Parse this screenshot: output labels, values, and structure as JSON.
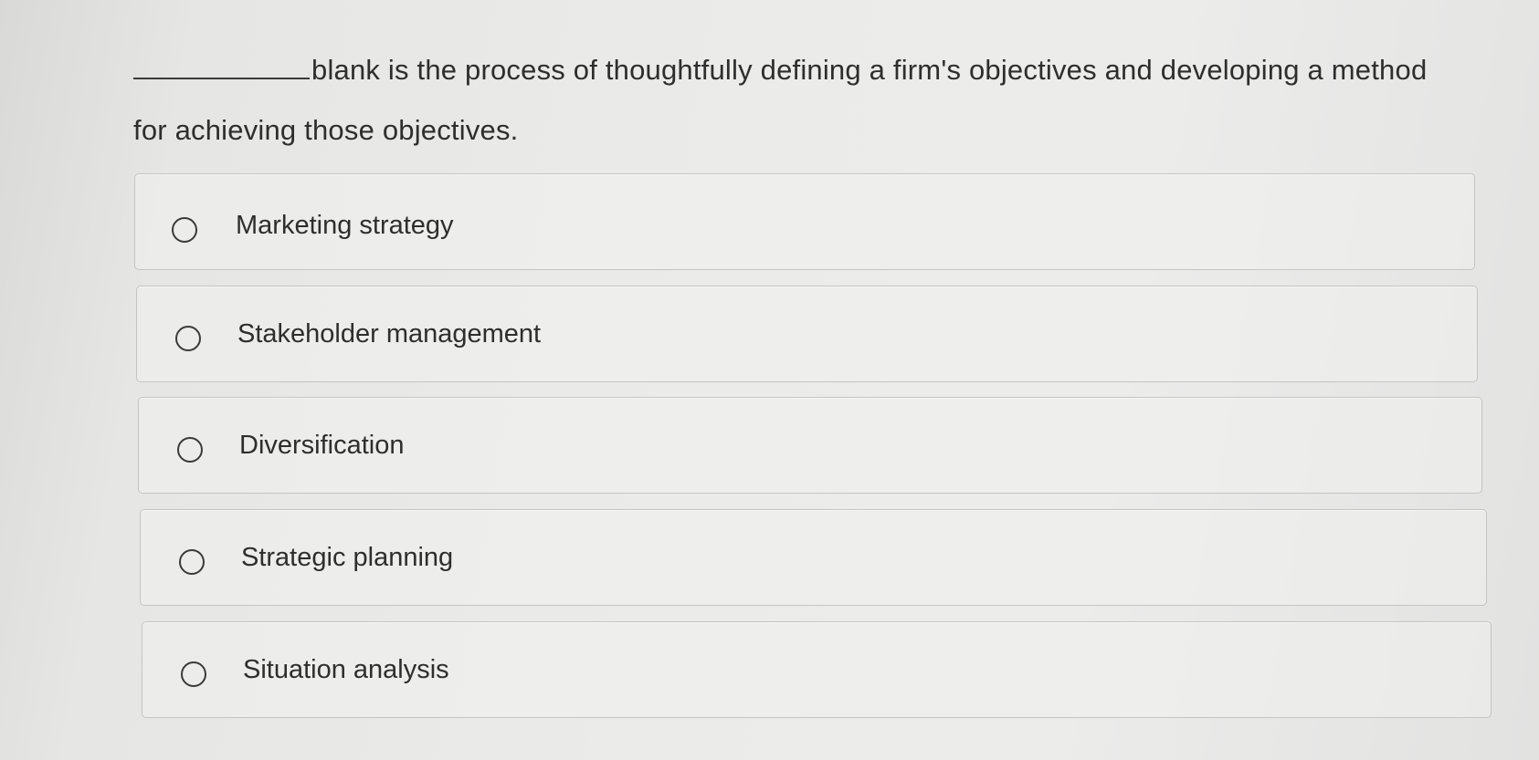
{
  "question": {
    "text": "blank is the process of thoughtfully defining a firm's objectives and developing a method for achieving those objectives."
  },
  "options": [
    {
      "label": "Marketing strategy",
      "selected": false
    },
    {
      "label": "Stakeholder management",
      "selected": false
    },
    {
      "label": "Diversification",
      "selected": false
    },
    {
      "label": "Strategic planning",
      "selected": false
    },
    {
      "label": "Situation analysis",
      "selected": false
    }
  ]
}
